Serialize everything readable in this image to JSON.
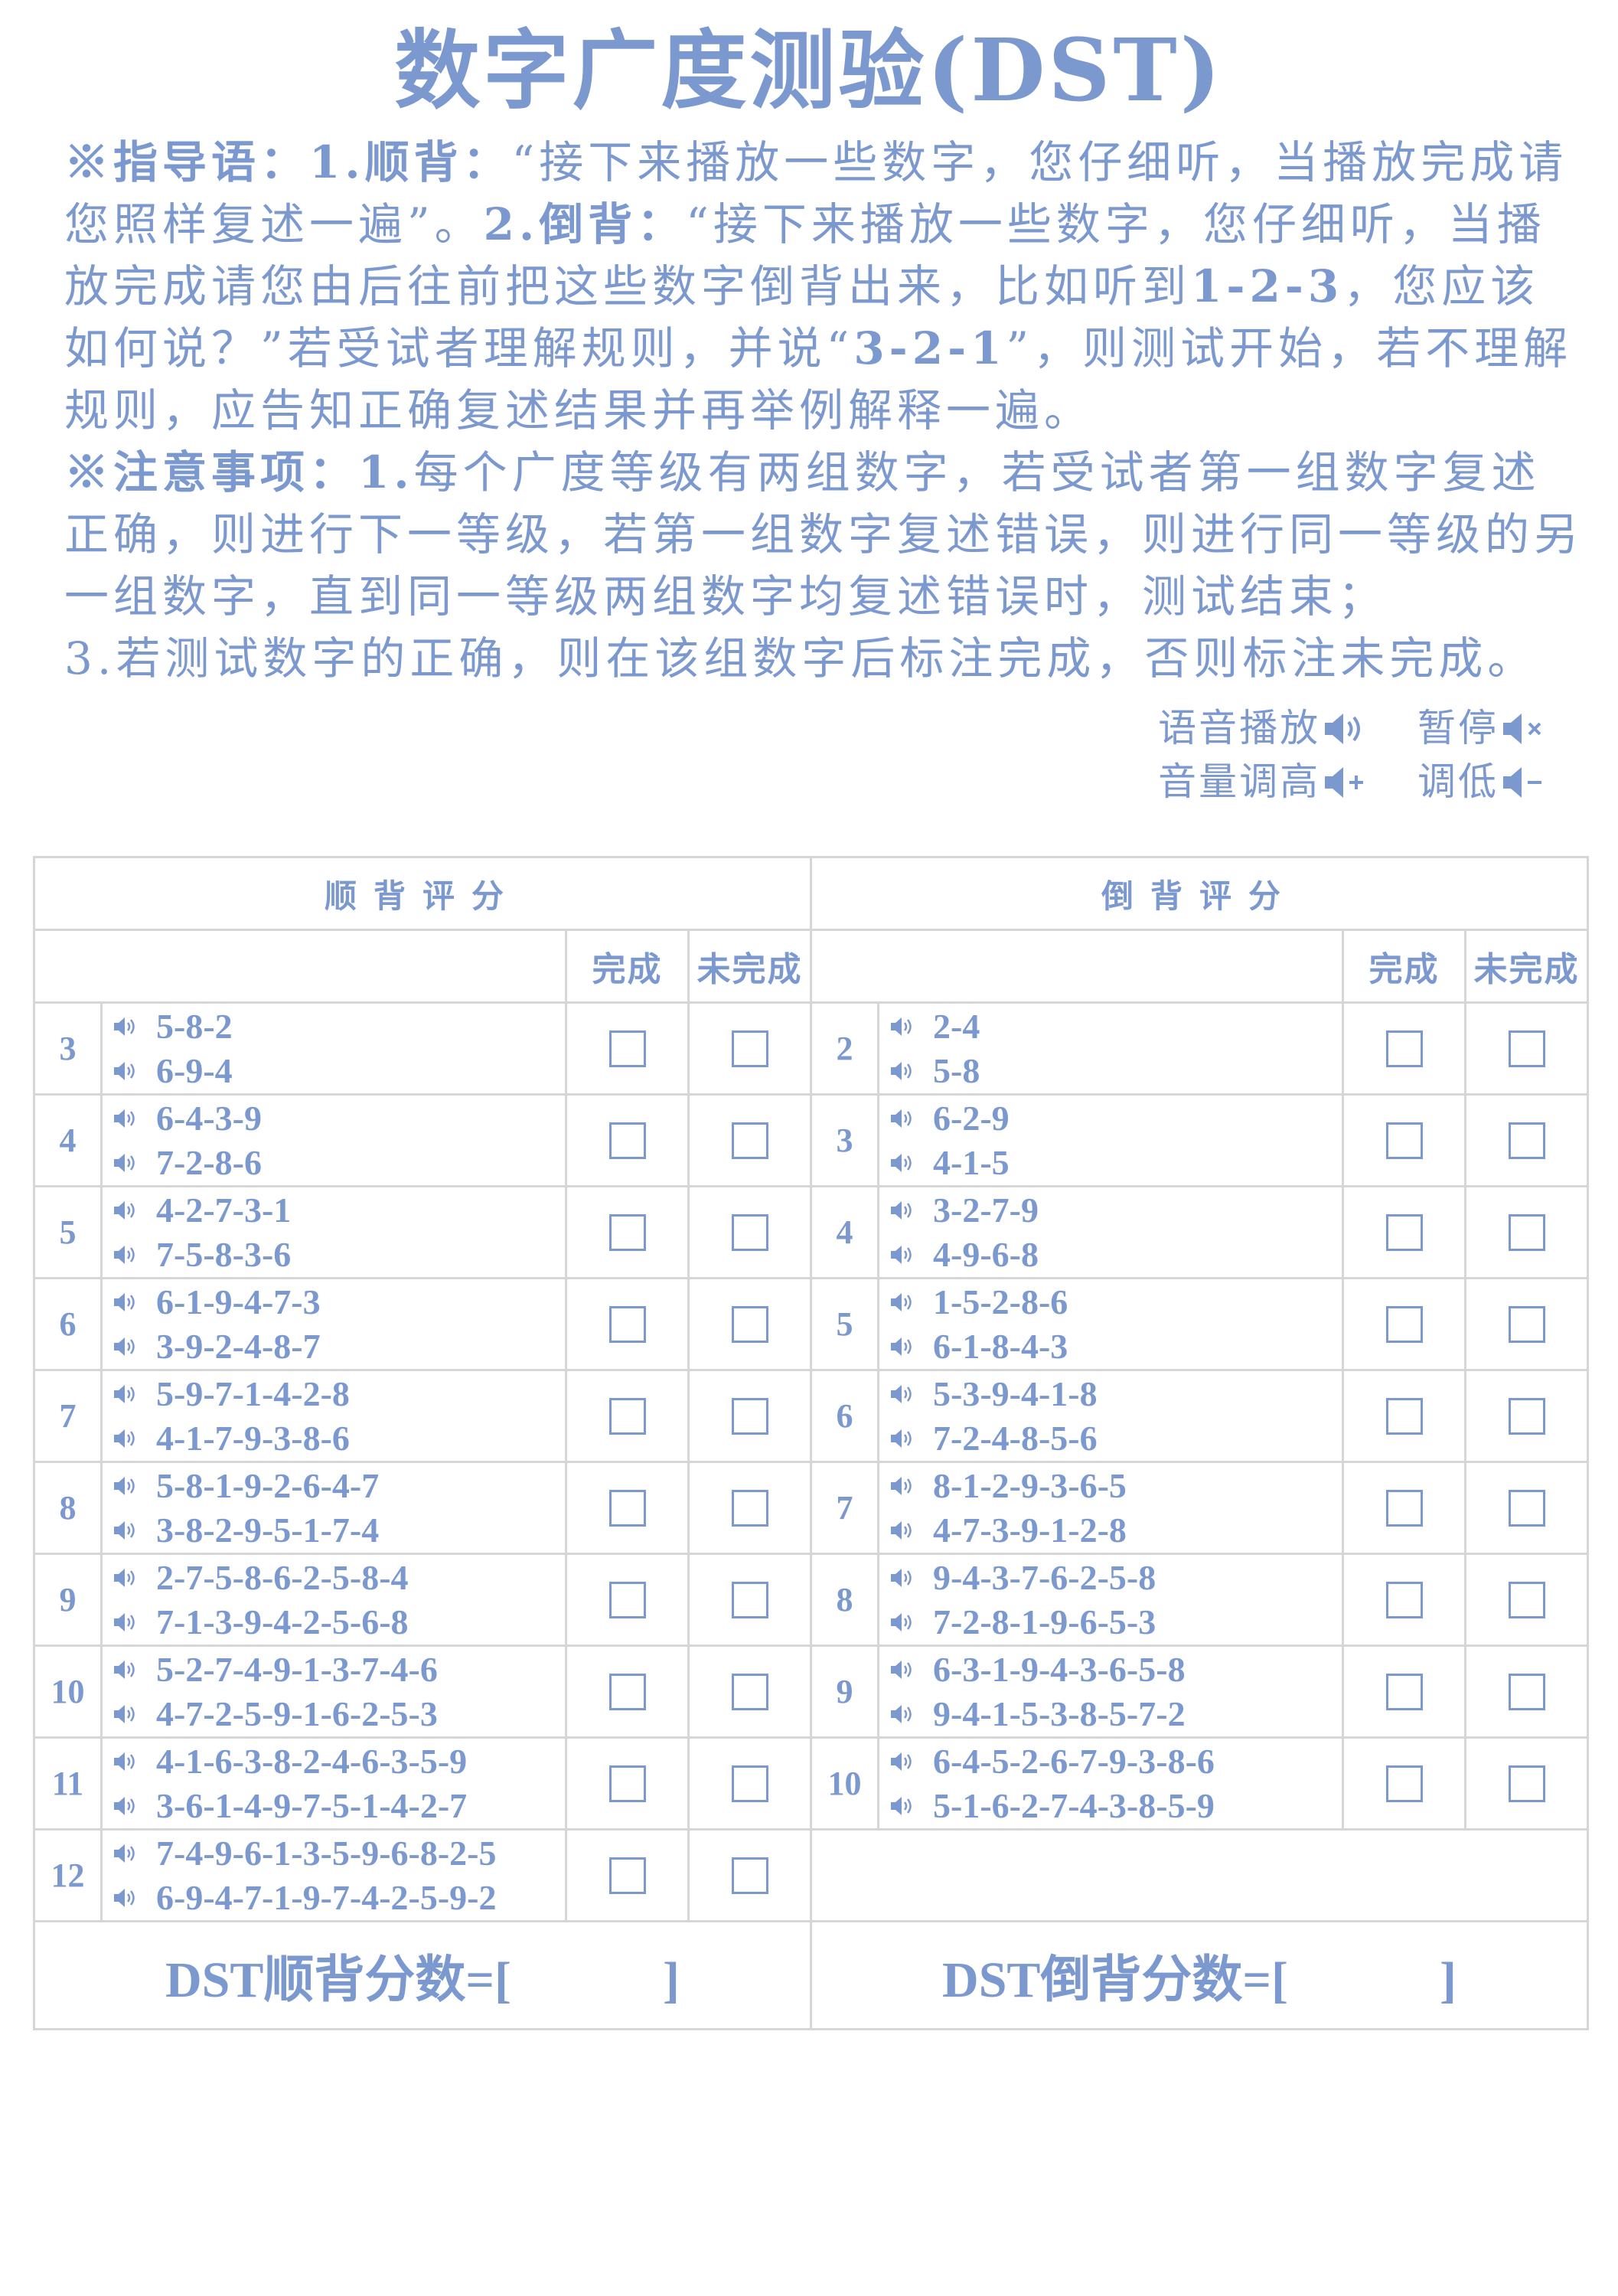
{
  "title": "数字广度测验(DST)",
  "instructions": {
    "guide_label": "※指导语：",
    "forward_label": "1.顺背：",
    "forward_text": "“接下来播放一些数字，您仔细听，当播放完成请您照样复述一遍”。",
    "backward_label": "2.倒背：",
    "backward_text_1": "“接下来播放一些数字，您仔细听，当播放完成请您由后往前把这些数字倒背出来，比如听到",
    "example_1": "1-2-3",
    "backward_text_2": "，您应该如何说？”若受试者理解规则，并说“",
    "example_2": "3-2-1",
    "backward_text_3": "”，则测试开始，若不理解规则，应告知正确复述结果并再举例解释一遍。",
    "notes_label": "※注意事项：",
    "note_1_num": "1.",
    "note_1_text": "每个广度等级有两组数字，若受试者第一组数字复述正确，则进行下一等级，若第一组数字复述错误，则进行同一等级的另一组数字，直到同一等级两组数字均复述错误时，测试结束；",
    "note_3_text": "3.若测试数字的正确，则在该组数字后标注完成，否则标注未完成。"
  },
  "controls": {
    "play": "语音播放",
    "pause": "暂停",
    "volume_up": "音量调高",
    "volume_down": "调低",
    "icons": [
      "speaker-wave-icon",
      "speaker-mute-icon",
      "speaker-plus-icon",
      "speaker-minus-icon"
    ]
  },
  "table": {
    "forward_header": "顺背评分",
    "backward_header": "倒背评分",
    "done_label": "完成",
    "not_done_label": "未完成",
    "forward_rows": [
      {
        "level": "3",
        "seqs": [
          "5-8-2",
          "6-9-4"
        ]
      },
      {
        "level": "4",
        "seqs": [
          "6-4-3-9",
          "7-2-8-6"
        ]
      },
      {
        "level": "5",
        "seqs": [
          "4-2-7-3-1",
          "7-5-8-3-6"
        ]
      },
      {
        "level": "6",
        "seqs": [
          "6-1-9-4-7-3",
          "3-9-2-4-8-7"
        ]
      },
      {
        "level": "7",
        "seqs": [
          "5-9-7-1-4-2-8",
          "4-1-7-9-3-8-6"
        ]
      },
      {
        "level": "8",
        "seqs": [
          "5-8-1-9-2-6-4-7",
          "3-8-2-9-5-1-7-4"
        ]
      },
      {
        "level": "9",
        "seqs": [
          "2-7-5-8-6-2-5-8-4",
          "7-1-3-9-4-2-5-6-8"
        ]
      },
      {
        "level": "10",
        "seqs": [
          "5-2-7-4-9-1-3-7-4-6",
          "4-7-2-5-9-1-6-2-5-3"
        ]
      },
      {
        "level": "11",
        "seqs": [
          "4-1-6-3-8-2-4-6-3-5-9",
          "3-6-1-4-9-7-5-1-4-2-7"
        ]
      },
      {
        "level": "12",
        "seqs": [
          "7-4-9-6-1-3-5-9-6-8-2-5",
          "6-9-4-7-1-9-7-4-2-5-9-2"
        ]
      }
    ],
    "backward_rows": [
      {
        "level": "2",
        "seqs": [
          "2-4",
          "5-8"
        ]
      },
      {
        "level": "3",
        "seqs": [
          "6-2-9",
          "4-1-5"
        ]
      },
      {
        "level": "4",
        "seqs": [
          "3-2-7-9",
          "4-9-6-8"
        ]
      },
      {
        "level": "5",
        "seqs": [
          "1-5-2-8-6",
          "6-1-8-4-3"
        ]
      },
      {
        "level": "6",
        "seqs": [
          "5-3-9-4-1-8",
          "7-2-4-8-5-6"
        ]
      },
      {
        "level": "7",
        "seqs": [
          "8-1-2-9-3-6-5",
          "4-7-3-9-1-2-8"
        ]
      },
      {
        "level": "8",
        "seqs": [
          "9-4-3-7-6-2-5-8",
          "7-2-8-1-9-6-5-3"
        ]
      },
      {
        "level": "9",
        "seqs": [
          "6-3-1-9-4-3-6-5-8",
          "9-4-1-5-3-8-5-7-2"
        ]
      },
      {
        "level": "10",
        "seqs": [
          "6-4-5-2-6-7-9-3-8-6",
          "5-1-6-2-7-4-3-8-5-9"
        ]
      }
    ],
    "forward_score": "DST顺背分数=[　　　]",
    "backward_score": "DST倒背分数=[　　　]"
  },
  "colors": {
    "text": "#7c99cf",
    "grid": "#d6d6d6"
  }
}
